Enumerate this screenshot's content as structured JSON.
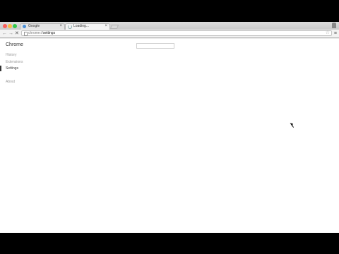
{
  "browser": {
    "tabs": [
      {
        "label": "Google",
        "close": "×",
        "active": false
      },
      {
        "label": "Loading...",
        "close": "×",
        "active": true
      }
    ],
    "toolbar": {
      "back": "←",
      "forward": "→",
      "stop": "✕",
      "url_scheme": "chrome://",
      "url_host": "settings",
      "star": "☆",
      "menu": "≡"
    }
  },
  "settings": {
    "title": "Chrome",
    "nav": {
      "history": "History",
      "extensions": "Extensions",
      "settings": "Settings",
      "about": "About"
    },
    "search_placeholder": ""
  },
  "icons": {
    "favicon": "google-favicon",
    "spinner": "loading-spinner",
    "star": "star-icon",
    "menu": "hamburger-menu-icon"
  },
  "colors": {
    "close": "#fc605c",
    "minimize": "#fdbc40",
    "maximize": "#34c84a",
    "active_nav": "#333333"
  }
}
